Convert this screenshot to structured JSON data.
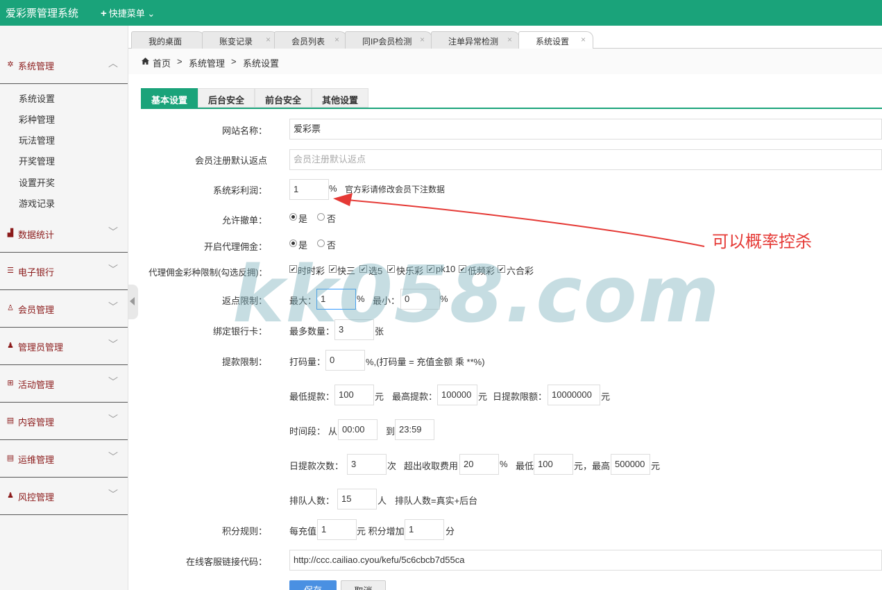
{
  "topbar": {
    "brand": "爱彩票管理系统",
    "quick_menu": "快捷菜单"
  },
  "sidebar": {
    "groups": [
      {
        "label": "系统管理",
        "icon": "gear-icon"
      },
      {
        "label": "数据统计",
        "icon": "bar-chart-icon"
      },
      {
        "label": "电子银行",
        "icon": "list-icon"
      },
      {
        "label": "会员管理",
        "icon": "user-outline-icon"
      },
      {
        "label": "管理员管理",
        "icon": "user-icon"
      },
      {
        "label": "活动管理",
        "icon": "gift-icon"
      },
      {
        "label": "内容管理",
        "icon": "document-icon"
      },
      {
        "label": "运维管理",
        "icon": "document-icon"
      },
      {
        "label": "风控管理",
        "icon": "user-icon"
      }
    ],
    "sub_items": [
      "系统设置",
      "彩种管理",
      "玩法管理",
      "开奖管理",
      "设置开奖",
      "游戏记录"
    ]
  },
  "tabs": [
    {
      "label": "我的桌面"
    },
    {
      "label": "账变记录"
    },
    {
      "label": "会员列表"
    },
    {
      "label": "同IP会员检测"
    },
    {
      "label": "注单异常检测"
    },
    {
      "label": "系统设置",
      "active": true
    }
  ],
  "breadcrumb": [
    "首页",
    ">",
    "系统管理",
    ">",
    "系统设置"
  ],
  "content_tabs": [
    "基本设置",
    "后台安全",
    "前台安全",
    "其他设置"
  ],
  "form": {
    "site_name": {
      "label": "网站名称：",
      "value": "爱彩票"
    },
    "default_rebate": {
      "label": "会员注册默认返点",
      "placeholder": "会员注册默认返点"
    },
    "profit": {
      "label": "系统彩利润：",
      "value": "1",
      "unit": "%",
      "note": "官方彩请修改会员下注数据"
    },
    "allow_cancel": {
      "label": "允许撤单：",
      "yes": "是",
      "no": "否"
    },
    "agent_commission": {
      "label": "开启代理佣金：",
      "yes": "是",
      "no": "否"
    },
    "commission_limit": {
      "label": "代理佣金彩种限制(勾选反拥)：",
      "options": [
        "时时彩",
        "快三",
        "选5",
        "快乐彩",
        "pk10",
        "低频彩",
        "六合彩"
      ]
    },
    "rebate_limit": {
      "label": "返点限制：",
      "max_label": "最大：",
      "max": "1",
      "min_label": "最小：",
      "min": "0",
      "unit": "%"
    },
    "bank_card": {
      "label": "绑定银行卡：",
      "max_label": "最多数量：",
      "value": "3",
      "unit": "张"
    },
    "withdraw": {
      "label": "提款限制：",
      "code_label": "打码量：",
      "code_value": "0",
      "code_note": "%,(打码量 = 充值金额 乘 **%)",
      "min_label": "最低提款：",
      "min_value": "100",
      "yuan": "元",
      "max_label": "最高提款：",
      "max_value": "100000",
      "daily_label": "日提款限额：",
      "daily_value": "10000000",
      "time_label": "时间段：",
      "from": "从",
      "from_value": "00:00",
      "to": "到",
      "to_value": "23:59",
      "count_label": "日提款次数：",
      "count_value": "3",
      "count_unit": "次",
      "fee_label": "超出收取费用",
      "fee_value": "20",
      "percent": "%",
      "fee_min_label": "最低",
      "fee_min_value": "100",
      "fee_max_label": "元，最高",
      "fee_max_value": "500000",
      "queue_label": "排队人数：",
      "queue_value": "15",
      "queue_unit": "人",
      "queue_note": "排队人数=真实+后台"
    },
    "points": {
      "label": "积分规则：",
      "per_label": "每充值",
      "per_value": "1",
      "add_label": "元 积分增加",
      "add_value": "1",
      "unit": "分"
    },
    "service": {
      "label": "在线客服链接代码：",
      "value": "http://ccc.cailiao.cyou/kefu/5c6cbcb7d55ca"
    },
    "save_label": "保存",
    "cancel_label": "取消"
  },
  "annotation": {
    "text": "可以概率控杀",
    "color": "#e53935"
  },
  "watermark": "kk058.com",
  "colors": {
    "accent": "#1aa37a",
    "annotation": "#e53935"
  }
}
